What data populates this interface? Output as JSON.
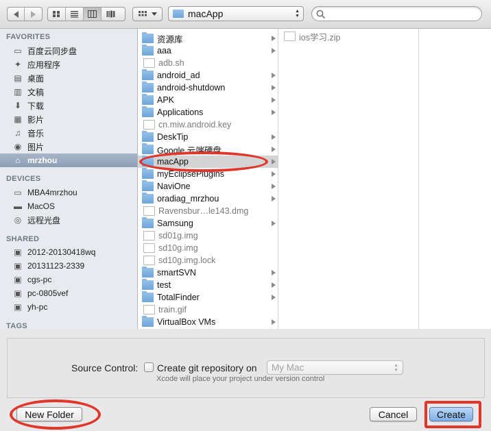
{
  "toolbar": {
    "path_popup": "macApp",
    "search_placeholder": ""
  },
  "sidebar": {
    "favorites_header": "FAVORITES",
    "favorites": [
      {
        "label": "百度云同步盘",
        "icon": "folder-icon"
      },
      {
        "label": "应用程序",
        "icon": "applications-icon"
      },
      {
        "label": "桌面",
        "icon": "desktop-icon"
      },
      {
        "label": "文稿",
        "icon": "documents-icon"
      },
      {
        "label": "下载",
        "icon": "downloads-icon"
      },
      {
        "label": "影片",
        "icon": "movies-icon"
      },
      {
        "label": "音乐",
        "icon": "music-icon"
      },
      {
        "label": "图片",
        "icon": "pictures-icon"
      },
      {
        "label": "mrzhou",
        "icon": "home-icon"
      }
    ],
    "devices_header": "DEVICES",
    "devices": [
      {
        "label": "MBA4mrzhou",
        "icon": "laptop-icon"
      },
      {
        "label": "MacOS",
        "icon": "disk-icon"
      },
      {
        "label": "远程光盘",
        "icon": "optical-disc-icon"
      }
    ],
    "shared_header": "SHARED",
    "shared": [
      {
        "label": "2012-20130418wq",
        "icon": "monitor-icon"
      },
      {
        "label": "20131123-2339",
        "icon": "monitor-icon"
      },
      {
        "label": "cgs-pc",
        "icon": "monitor-icon"
      },
      {
        "label": "pc-0805vef",
        "icon": "monitor-icon"
      },
      {
        "label": "yh-pc",
        "icon": "monitor-icon"
      }
    ],
    "tags_header": "TAGS"
  },
  "column1": [
    {
      "name": "资源库",
      "kind": "folder",
      "expandable": true
    },
    {
      "name": "aaa",
      "kind": "folder",
      "expandable": true
    },
    {
      "name": "adb.sh",
      "kind": "file",
      "expandable": false
    },
    {
      "name": "android_ad",
      "kind": "folder",
      "expandable": true
    },
    {
      "name": "android-shutdown",
      "kind": "folder",
      "expandable": true
    },
    {
      "name": "APK",
      "kind": "folder",
      "expandable": true
    },
    {
      "name": "Applications",
      "kind": "folder",
      "expandable": true
    },
    {
      "name": "cn.miw.android.key",
      "kind": "file",
      "expandable": false
    },
    {
      "name": "DeskTip",
      "kind": "folder",
      "expandable": true
    },
    {
      "name": "Google 云端硬盘",
      "kind": "folder",
      "expandable": true
    },
    {
      "name": "macApp",
      "kind": "folder",
      "expandable": true
    },
    {
      "name": "myEclipsePlugins",
      "kind": "folder",
      "expandable": true
    },
    {
      "name": "NaviOne",
      "kind": "folder",
      "expandable": true
    },
    {
      "name": "oradiag_mrzhou",
      "kind": "folder",
      "expandable": true
    },
    {
      "name": "Ravensbur…le143.dmg",
      "kind": "file",
      "expandable": false
    },
    {
      "name": "Samsung",
      "kind": "folder",
      "expandable": true
    },
    {
      "name": "sd01g.img",
      "kind": "file",
      "expandable": false
    },
    {
      "name": "sd10g.img",
      "kind": "file",
      "expandable": false
    },
    {
      "name": "sd10g.img.lock",
      "kind": "file",
      "expandable": false
    },
    {
      "name": "smartSVN",
      "kind": "folder",
      "expandable": true
    },
    {
      "name": "test",
      "kind": "folder",
      "expandable": true
    },
    {
      "name": "TotalFinder",
      "kind": "folder",
      "expandable": true
    },
    {
      "name": "train.gif",
      "kind": "file",
      "expandable": false
    },
    {
      "name": "VirtualBox VMs",
      "kind": "folder",
      "expandable": true
    }
  ],
  "column2": [
    {
      "name": "ios学习.zip",
      "kind": "file"
    }
  ],
  "options": {
    "source_control_label": "Source Control:",
    "checkbox_label": "Create git repository on",
    "checkbox_checked": false,
    "location_popup": "My Mac",
    "hint": "Xcode will place your project under version control"
  },
  "buttons": {
    "new_folder": "New Folder",
    "cancel": "Cancel",
    "create": "Create"
  },
  "colors": {
    "annotation": "#e0362c",
    "sidebar_selection": "#8e9fb6",
    "folder": "#6fa4d9"
  }
}
